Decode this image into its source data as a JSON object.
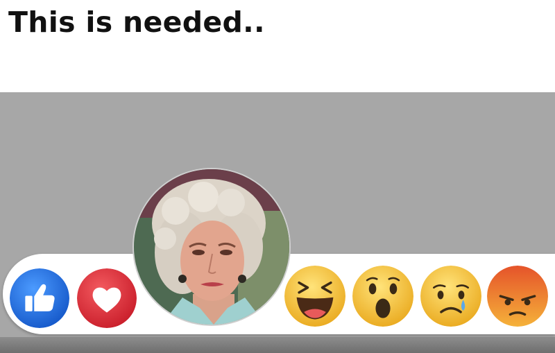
{
  "caption": "This is needed..",
  "reactions": [
    {
      "name": "like",
      "icon": "thumbs-up-icon",
      "color": "#1f6fe0"
    },
    {
      "name": "love",
      "icon": "heart-icon",
      "color": "#e0303a"
    },
    {
      "name": "custom",
      "icon": "portrait-avatar"
    },
    {
      "name": "haha",
      "icon": "laughing-face-icon",
      "color": "#f7c23a"
    },
    {
      "name": "wow",
      "icon": "surprised-face-icon",
      "color": "#f7c23a"
    },
    {
      "name": "sad",
      "icon": "sad-face-icon",
      "color": "#f7c23a"
    },
    {
      "name": "angry",
      "icon": "angry-face-icon",
      "color": "#e8762f"
    }
  ],
  "colors": {
    "background_gray": "#a7a7a7",
    "bar": "#ffffff"
  }
}
